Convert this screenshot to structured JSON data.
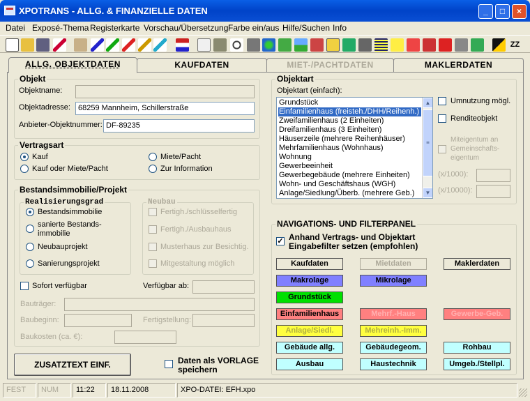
{
  "window": {
    "title": "XPOTRANS - ALLG. & FINANZIELLE DATEN",
    "min": "_",
    "max": "□",
    "close": "×"
  },
  "menu": [
    "Datei",
    "Exposé-Thema",
    "Registerkarte",
    "Vorschau/Übersetzung",
    "Farbe ein/aus",
    "Hilfe/Suchen",
    "Info"
  ],
  "toolbar": {
    "zz_label": "ZZ"
  },
  "tabs": [
    "ALLG. OBJEKTDATEN",
    "KAUFDATEN",
    "MIET-/PACHTDATEN",
    "MAKLERDATEN"
  ],
  "objekt": {
    "title": "Objekt",
    "name_label": "Objektname:",
    "name_value": "",
    "adresse_label": "Objektadresse:",
    "adresse_value": "68259 Mannheim, Schillerstraße",
    "anbieter_label": "Anbieter-Objektnummer:",
    "anbieter_value": "DF-89235"
  },
  "vertragsart": {
    "title": "Vertragsart",
    "options": [
      "Kauf",
      "Miete/Pacht",
      "Kauf oder Miete/Pacht",
      "Zur Information"
    ],
    "selected": "Kauf"
  },
  "bestand": {
    "title": "Bestandsimmobilie/Projekt",
    "realisierung_title": "Realisierungsgrad",
    "realisierung": [
      "Bestandsimmobilie",
      "sanierte Bestands-",
      "immobilie",
      "Neubauprojekt",
      "Sanierungsprojekt"
    ],
    "neubau_title": "Neubau",
    "neubau": [
      "Fertigh./schlüsselfertig",
      "Fertigh./Ausbauhaus",
      "Musterhaus zur Besichtig.",
      "Mitgestaltung möglich"
    ],
    "sofort": "Sofort verfügbar",
    "verfuegbar_ab": "Verfügbar ab:",
    "bautraeger": "Bauträger:",
    "baubeginn": "Baubeginn:",
    "fertigstellung": "Fertigstellung:",
    "baukosten": "Baukosten  (ca. €):"
  },
  "zusatztext": "ZUSATZTEXT EINF.",
  "vorlage": [
    "Daten als VORLAGE",
    "speichern"
  ],
  "objektart": {
    "title": "Objektart",
    "list_label": "Objektart (einfach):",
    "items": [
      "Grundstück",
      "Einfamilienhaus (freisteh./DHH/Reihenh.)",
      "Zweifamilienhaus (2 Einheiten)",
      "Dreifamilienhaus (3 Einheiten)",
      "Häuserzeile (mehrere Reihenhäuser)",
      "Mehrfamilienhaus (Wohnhaus)",
      "Wohnung",
      "Gewerbeeinheit",
      "Gewerbegebäude (mehrere Einheiten)",
      "Wohn- und Geschäftshaus (WGH)",
      "Anlage/Siedlung/Überb. (mehrere Geb.)"
    ],
    "selected": "Einfamilienhaus (freisteh./DHH/Reihenh.)",
    "umnutzung": "Umnutzung mögl.",
    "rendite": "Renditeobjekt",
    "miteigentum": [
      "Miteigentum an",
      "Gemeinschafts-",
      "eigentum"
    ],
    "x1000": "(x/1000):",
    "x10000": "(x/10000):"
  },
  "nav": {
    "title": "NAVIGATIONS- UND FILTERPANEL",
    "filter": [
      "Anhand Vertrags- und Objektart",
      "Eingabefilter setzen (empfohlen)"
    ],
    "buttons": {
      "kaufdaten": "Kaufdaten",
      "mietdaten": "Mietdaten",
      "maklerdaten": "Maklerdaten",
      "makrolage": "Makrolage",
      "mikrolage": "Mikrolage",
      "grundstueck": "Grundstück",
      "einfamilienhaus": "Einfamilienhaus",
      "mfh": "Mehrf.-Haus",
      "gewerbe": "Gewerbe-Geb.",
      "anlage": "Anlage/Siedl.",
      "mehreinh": "Mehreinh.-Imm.",
      "gebaeude": "Gebäude allg.",
      "gebaeudegeom": "Gebäudegeom.",
      "rohbau": "Rohbau",
      "ausbau": "Ausbau",
      "haustechnik": "Haustechnik",
      "umgeb": "Umgeb./Stellpl."
    }
  },
  "status": {
    "fest": "FEST",
    "num": "NUM",
    "time": "11:22",
    "date": "18.11.2008",
    "file": "XPO-DATEI: EFH.xpo"
  },
  "colors": {
    "accent": "#316ac5",
    "blue_btn": "#8080ff",
    "green_btn": "#00e000",
    "red_btn": "#ff8080",
    "yellow_btn": "#ffff40",
    "cyan_btn": "#c0ffff"
  }
}
